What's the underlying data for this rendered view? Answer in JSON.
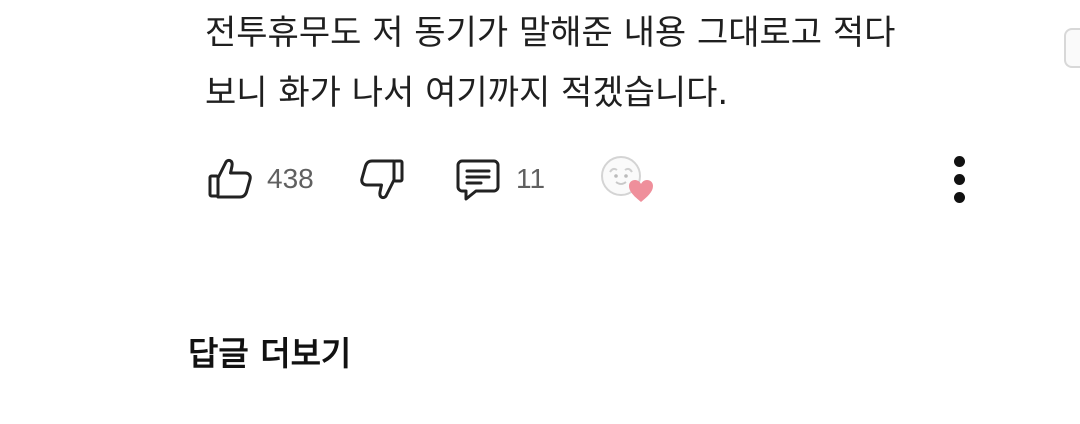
{
  "comment": {
    "lines": [
      "전투휴무도 저 동기가 말해준 내용 그대로고 적다",
      "보니 화가 나서 여기까지 적겠습니다."
    ]
  },
  "actions": {
    "like_count": "438",
    "reply_count": "11"
  },
  "more_replies_label": "답글 더보기",
  "icons": {
    "like": "thumbs-up-icon",
    "dislike": "thumbs-down-icon",
    "reply": "comment-icon",
    "creator_heart": "creator-heart-icon",
    "more": "more-vertical-icon"
  },
  "colors": {
    "text": "#1f1f1f",
    "count": "#606060",
    "heart": "#ef8f9b"
  }
}
